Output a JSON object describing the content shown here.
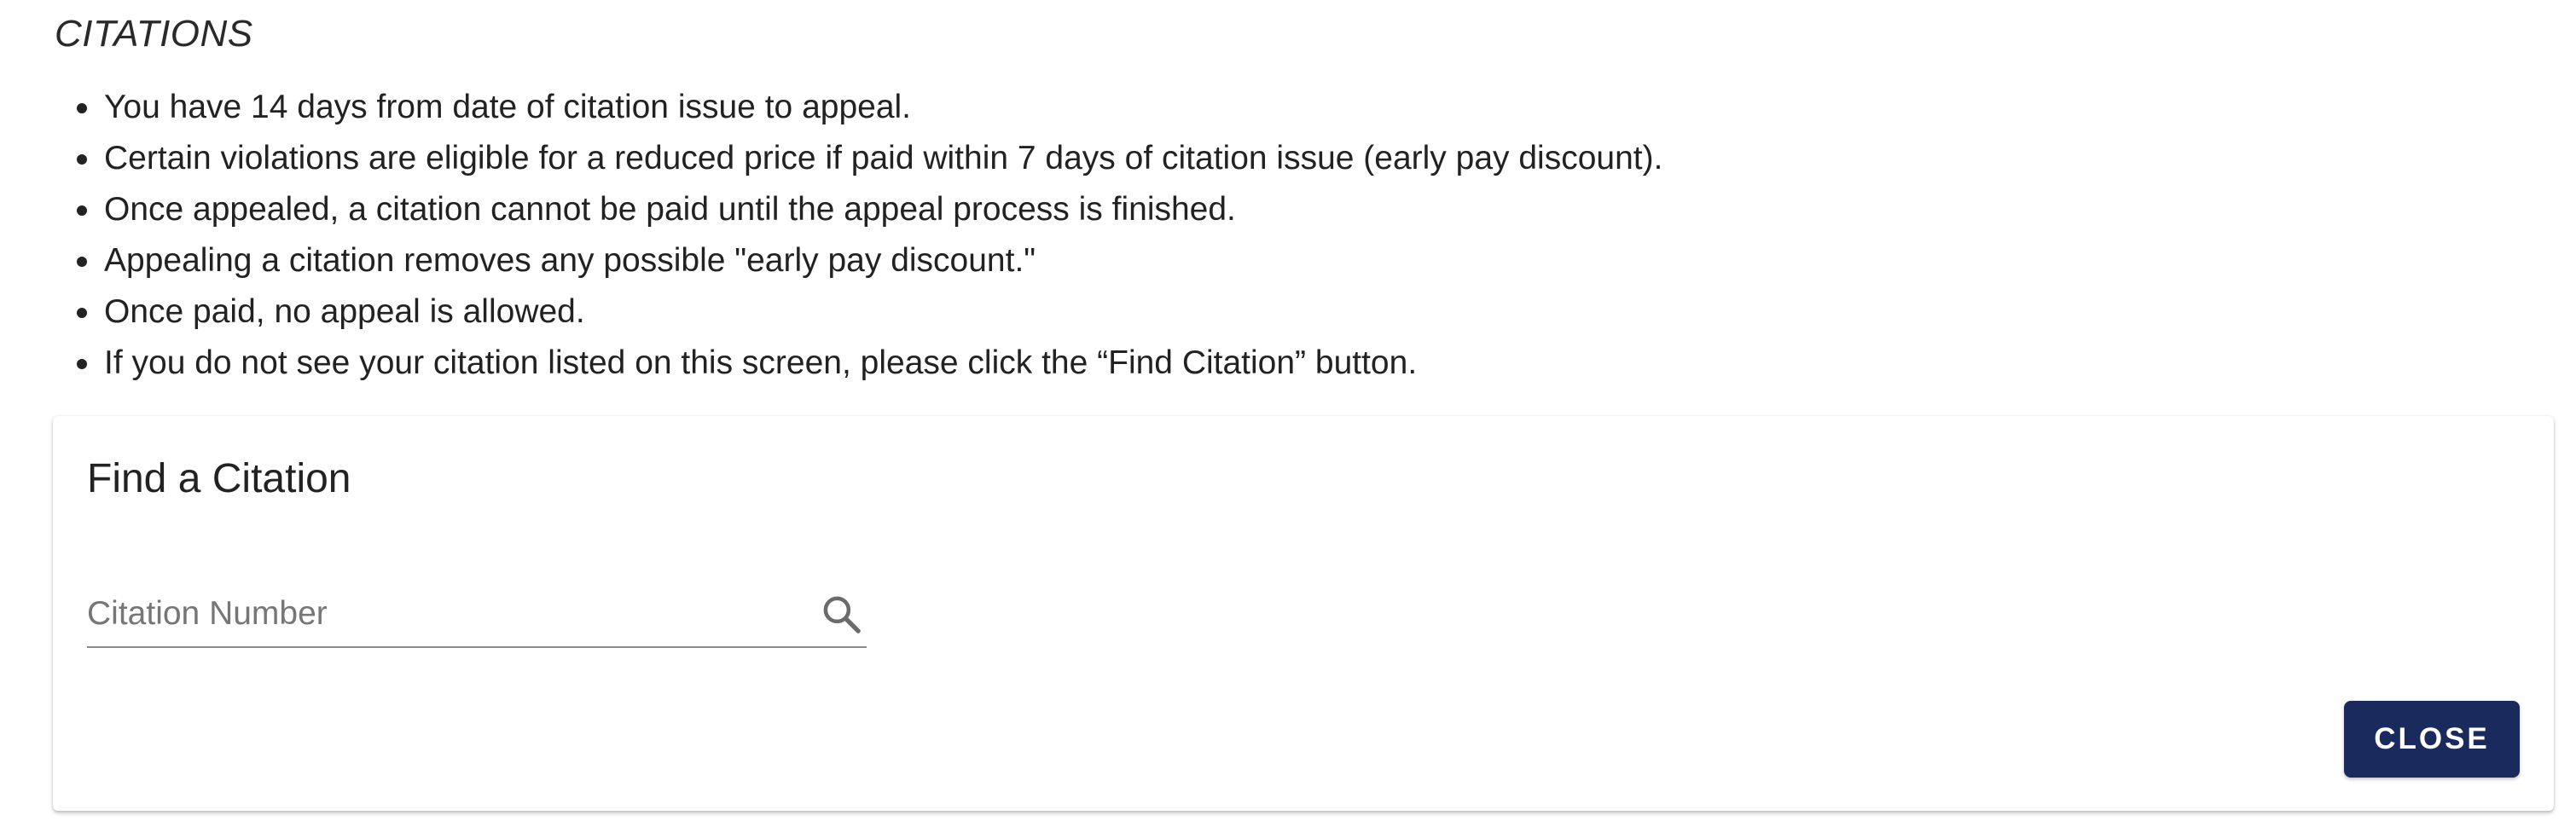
{
  "section": {
    "title": "CITATIONS"
  },
  "rules": [
    "You have 14 days from date of citation issue to appeal.",
    "Certain violations are eligible for a reduced price if paid within 7 days of citation issue (early pay discount).",
    "Once appealed, a citation cannot be paid until the appeal process is finished.",
    "Appealing a citation removes any possible \"early pay discount.\"",
    "Once paid, no appeal is allowed.",
    "If you do not see your citation listed on this screen, please click the “Find Citation” button."
  ],
  "find_citation": {
    "title": "Find a Citation",
    "input_placeholder": "Citation Number",
    "input_value": "",
    "search_icon": "search-icon",
    "close_label": "CLOSE"
  },
  "colors": {
    "close_button_bg": "#1b2a5c",
    "close_button_text": "#ffffff",
    "text": "#222222",
    "placeholder": "#767676"
  }
}
